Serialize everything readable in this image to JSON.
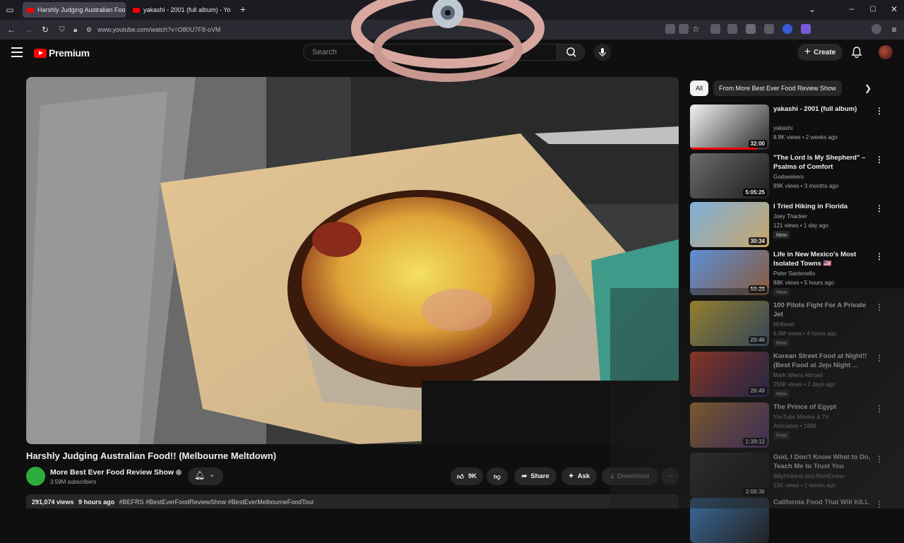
{
  "browser": {
    "tabs": [
      {
        "label": "Harshly Judging Australian Foo"
      },
      {
        "label": "yakashi - 2001 (full album) - Yo"
      }
    ],
    "url": "www.youtube.com/watch?v=O80U7F8-oVM"
  },
  "header": {
    "logo_text": "Premium",
    "search_placeholder": "Search",
    "create_label": "Create"
  },
  "video": {
    "title": "Harshly Judging Australian Food!! (Melbourne Meltdown)",
    "channel": "More Best Ever Food Review Show",
    "subscribers": "3.59M subscribers",
    "likes": "9K",
    "share_label": "Share",
    "ask_label": "Ask",
    "download_label": "Download",
    "views": "291,074 views",
    "age": "9 hours ago",
    "tags": "#BEFRS #BestEverFoodReviewShow #BestEverMelbourneFoodTour"
  },
  "chips": [
    {
      "label": "All"
    },
    {
      "label": "From More Best Ever Food Review Show"
    }
  ],
  "recommendations": [
    {
      "title": "yakashi - 2001 (full album)",
      "channel": "yakashi",
      "meta": "8.8K views • 2 weeks ago",
      "duration": "32:00",
      "progress": 0.85,
      "new": "",
      "colors": [
        "#f2f2f2",
        "#2a2a2a"
      ]
    },
    {
      "title": "\"The Lord is My Shepherd\" – Psalms of Comfort",
      "channel": "Godseekers",
      "meta": "99K views • 3 months ago",
      "duration": "5:05:25",
      "progress": 0,
      "new": "",
      "colors": [
        "#6b6b6b",
        "#1e1e1e"
      ]
    },
    {
      "title": "I Tried Hiking in Florida",
      "channel": "Joey Thacker",
      "meta": "121 views • 1 day ago",
      "duration": "30:34",
      "progress": 0,
      "new": "New",
      "colors": [
        "#7fb0d8",
        "#c9a66b"
      ]
    },
    {
      "title": "Life in New Mexico's Most Isolated Towns 🇺🇸",
      "channel": "Peter Santenello",
      "meta": "88K views • 5 hours ago",
      "duration": "50:28",
      "progress": 0,
      "new": "New",
      "colors": [
        "#5b8fd8",
        "#8a5a3a"
      ]
    },
    {
      "title": "100 Pilots Fight For A Private Jet",
      "channel": "MrBeast",
      "meta": "6.4M views • 4 hours ago",
      "duration": "28:46",
      "progress": 0,
      "new": "New",
      "colors": [
        "#e8c43a",
        "#4a6a8a"
      ]
    },
    {
      "title": "Korean Street Food at Night!! (Best Food at Jeju Night ...",
      "channel": "Mark Wiens Abroad",
      "meta": "255K views • 2 days ago",
      "duration": "26:49",
      "progress": 0,
      "new": "New",
      "colors": [
        "#d84a2a",
        "#2a2a6a"
      ]
    },
    {
      "title": "The Prince of Egypt",
      "channel": "YouTube Movies & TV",
      "meta": "Animation • 1998",
      "duration": "1:39:12",
      "progress": 0,
      "new": "Free",
      "colors": [
        "#c98a3a",
        "#5a3a8a"
      ]
    },
    {
      "title": "God, I Don't Know What to Do, Teach Me to Trust You",
      "channel": "BillyHolland and BibleEmber",
      "meta": "15K views • 2 weeks ago",
      "duration": "3:08:36",
      "progress": 0,
      "new": "",
      "colors": [
        "#3a3a3a",
        "#111111"
      ]
    },
    {
      "title": "California Food That Will KILL",
      "channel": "",
      "meta": "",
      "duration": "",
      "progress": 0,
      "new": "",
      "colors": [
        "#3a6a9a",
        "#222222"
      ]
    }
  ]
}
